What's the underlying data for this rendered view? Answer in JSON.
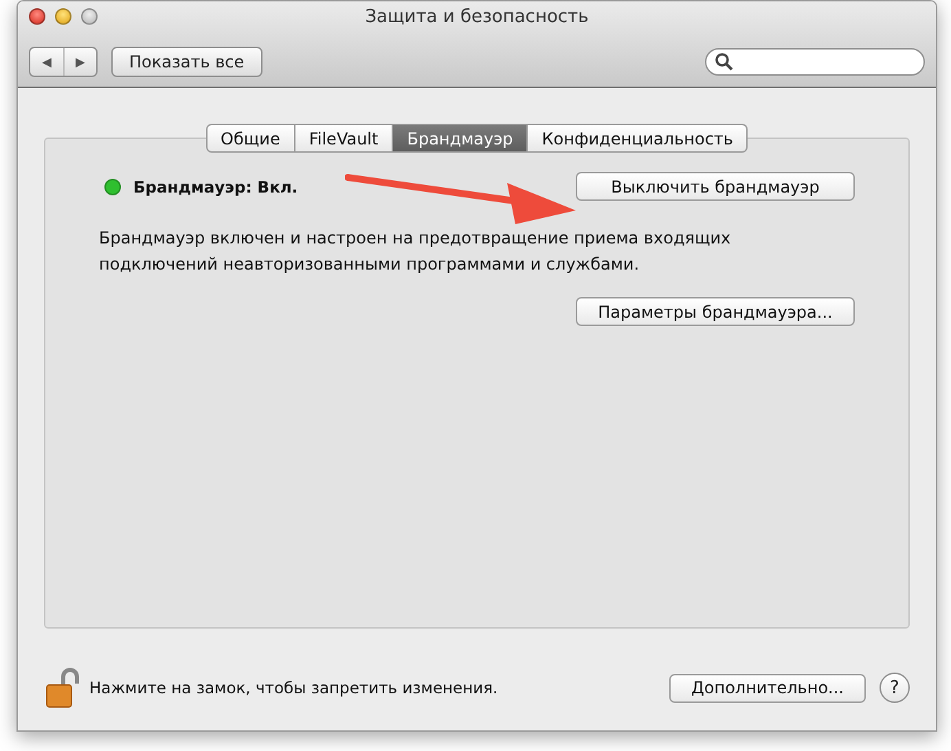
{
  "window": {
    "title": "Защита и безопасность"
  },
  "toolbar": {
    "back_symbol": "◀",
    "forward_symbol": "▶",
    "show_all_button": "Показать все"
  },
  "tabs": [
    {
      "label": "Общие",
      "selected": false
    },
    {
      "label": "FileVault",
      "selected": false
    },
    {
      "label": "Брандмауэр",
      "selected": true
    },
    {
      "label": "Конфиденциальность",
      "selected": false
    }
  ],
  "firewall": {
    "status": "Брандмауэр: Вкл.",
    "on": true,
    "toggle_button": "Выключить брандмауэр",
    "description": "Брандмауэр включен и настроен на предотвращение приема входящих подключений неавторизованными программами и службами.",
    "options_button": "Параметры брандмауэра..."
  },
  "footer": {
    "locked": false,
    "lock_text": "Нажмите на замок, чтобы запретить изменения.",
    "advanced_button": "Дополнительно...",
    "help_symbol": "?"
  }
}
